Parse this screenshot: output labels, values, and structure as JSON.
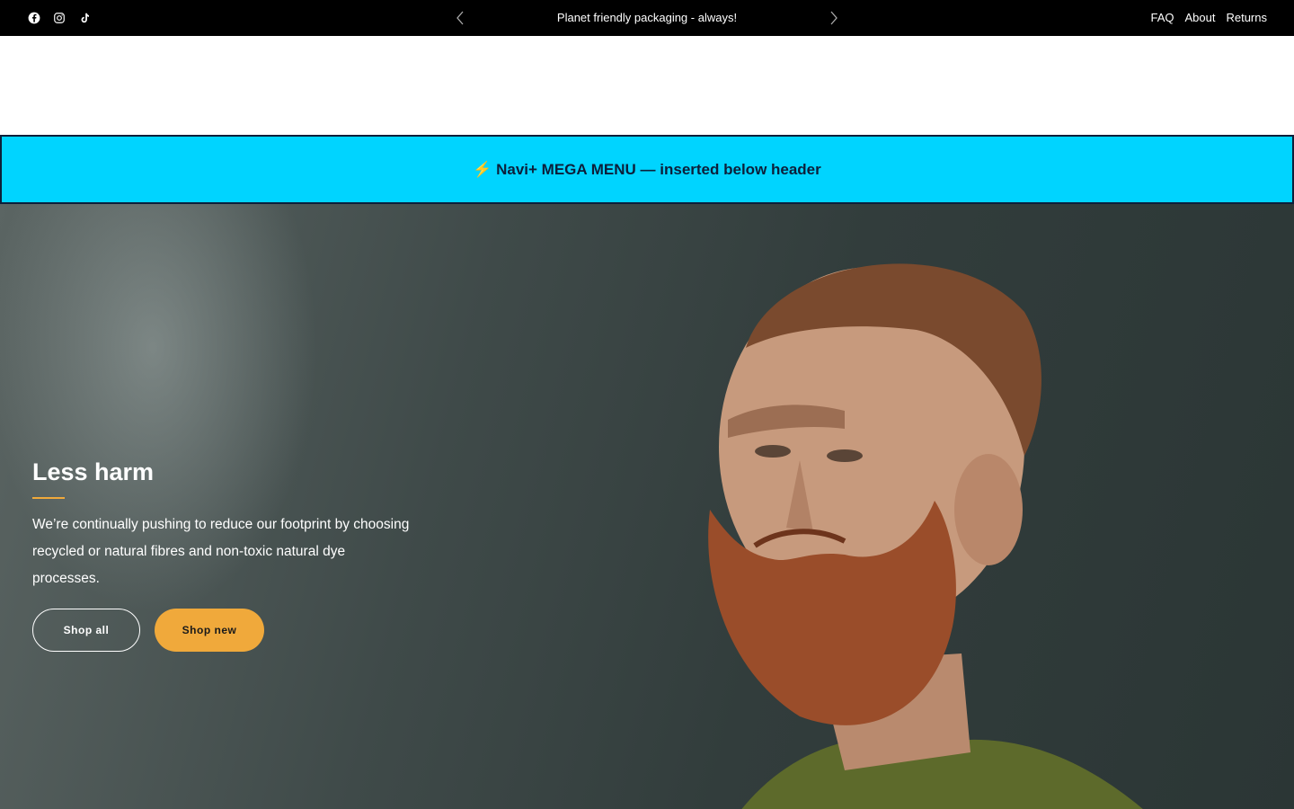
{
  "topbar": {
    "social_icons": [
      "facebook-icon",
      "instagram-icon",
      "tiktok-icon"
    ],
    "announcement": "Planet friendly packaging - always!",
    "links": [
      "FAQ",
      "About",
      "Returns"
    ]
  },
  "mega_menu": {
    "text": "⚡ Navi+ MEGA MENU — inserted below header",
    "bg_color": "#00d4ff"
  },
  "hero": {
    "title": "Less harm",
    "body": "We’re continually pushing to reduce our footprint by choosing recycled or natural fibres and non-toxic natural dye processes.",
    "buttons": {
      "shop_all": "Shop all",
      "shop_new": "Shop new"
    },
    "accent_color": "#f0a93b"
  }
}
